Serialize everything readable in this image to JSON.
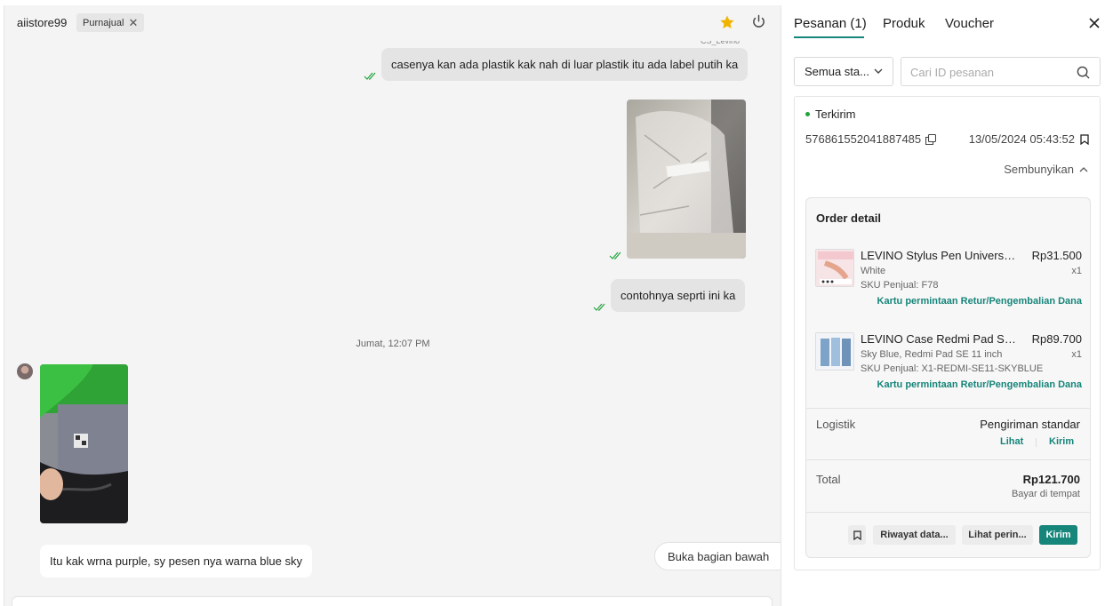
{
  "chat": {
    "header": {
      "name": "aiistore99",
      "tag": "Purnajual"
    },
    "partial_name": "CS_Levino",
    "messages": [
      {
        "text": "casenya kan ada plastik kak nah di luar plastik itu ada label putih ka",
        "direction": "out"
      },
      {
        "text": "contohnya seprti ini ka",
        "direction": "out"
      },
      {
        "text": "Itu kak wrna purple, sy pesen nya warna blue sky",
        "direction": "in"
      }
    ],
    "date_separator": "Jumat, 12:07 PM",
    "jump_button": "Buka bagian bawah"
  },
  "side": {
    "tabs": [
      "Pesanan (1)",
      "Produk",
      "Voucher"
    ],
    "filter": {
      "selected": "Semua sta..."
    },
    "search": {
      "placeholder": "Cari ID pesanan"
    },
    "order": {
      "status": "Terkirim",
      "id": "576861552041887485",
      "datetime": "13/05/2024 05:43:52",
      "collapse_label": "Sembunyikan",
      "detail_title": "Order detail",
      "items": [
        {
          "name": "LEVINO Stylus Pen Universal...",
          "price": "Rp31.500",
          "variant": "White",
          "qty": "x1",
          "sku": "SKU Penjual: F78",
          "link": "Kartu permintaan Retur/Pengembalian Dana"
        },
        {
          "name": "LEVINO Case Redmi Pad SE ...",
          "price": "Rp89.700",
          "variant": "Sky Blue, Redmi Pad SE 11 inch",
          "qty": "x1",
          "sku": "SKU Penjual: X1-REDMI-SE11-SKYBLUE",
          "link": "Kartu permintaan Retur/Pengembalian Dana"
        }
      ],
      "logistics": {
        "label": "Logistik",
        "value": "Pengiriman standar",
        "view": "Lihat",
        "send": "Kirim"
      },
      "total": {
        "label": "Total",
        "value": "Rp121.700",
        "payment": "Bayar di tempat"
      },
      "actions": {
        "history": "Riwayat data...",
        "details": "Lihat perin...",
        "send": "Kirim"
      }
    }
  },
  "colors": {
    "accent": "#16857a",
    "star": "#f0b400",
    "tick": "#21a33b",
    "status_dot": "#21a33b"
  }
}
